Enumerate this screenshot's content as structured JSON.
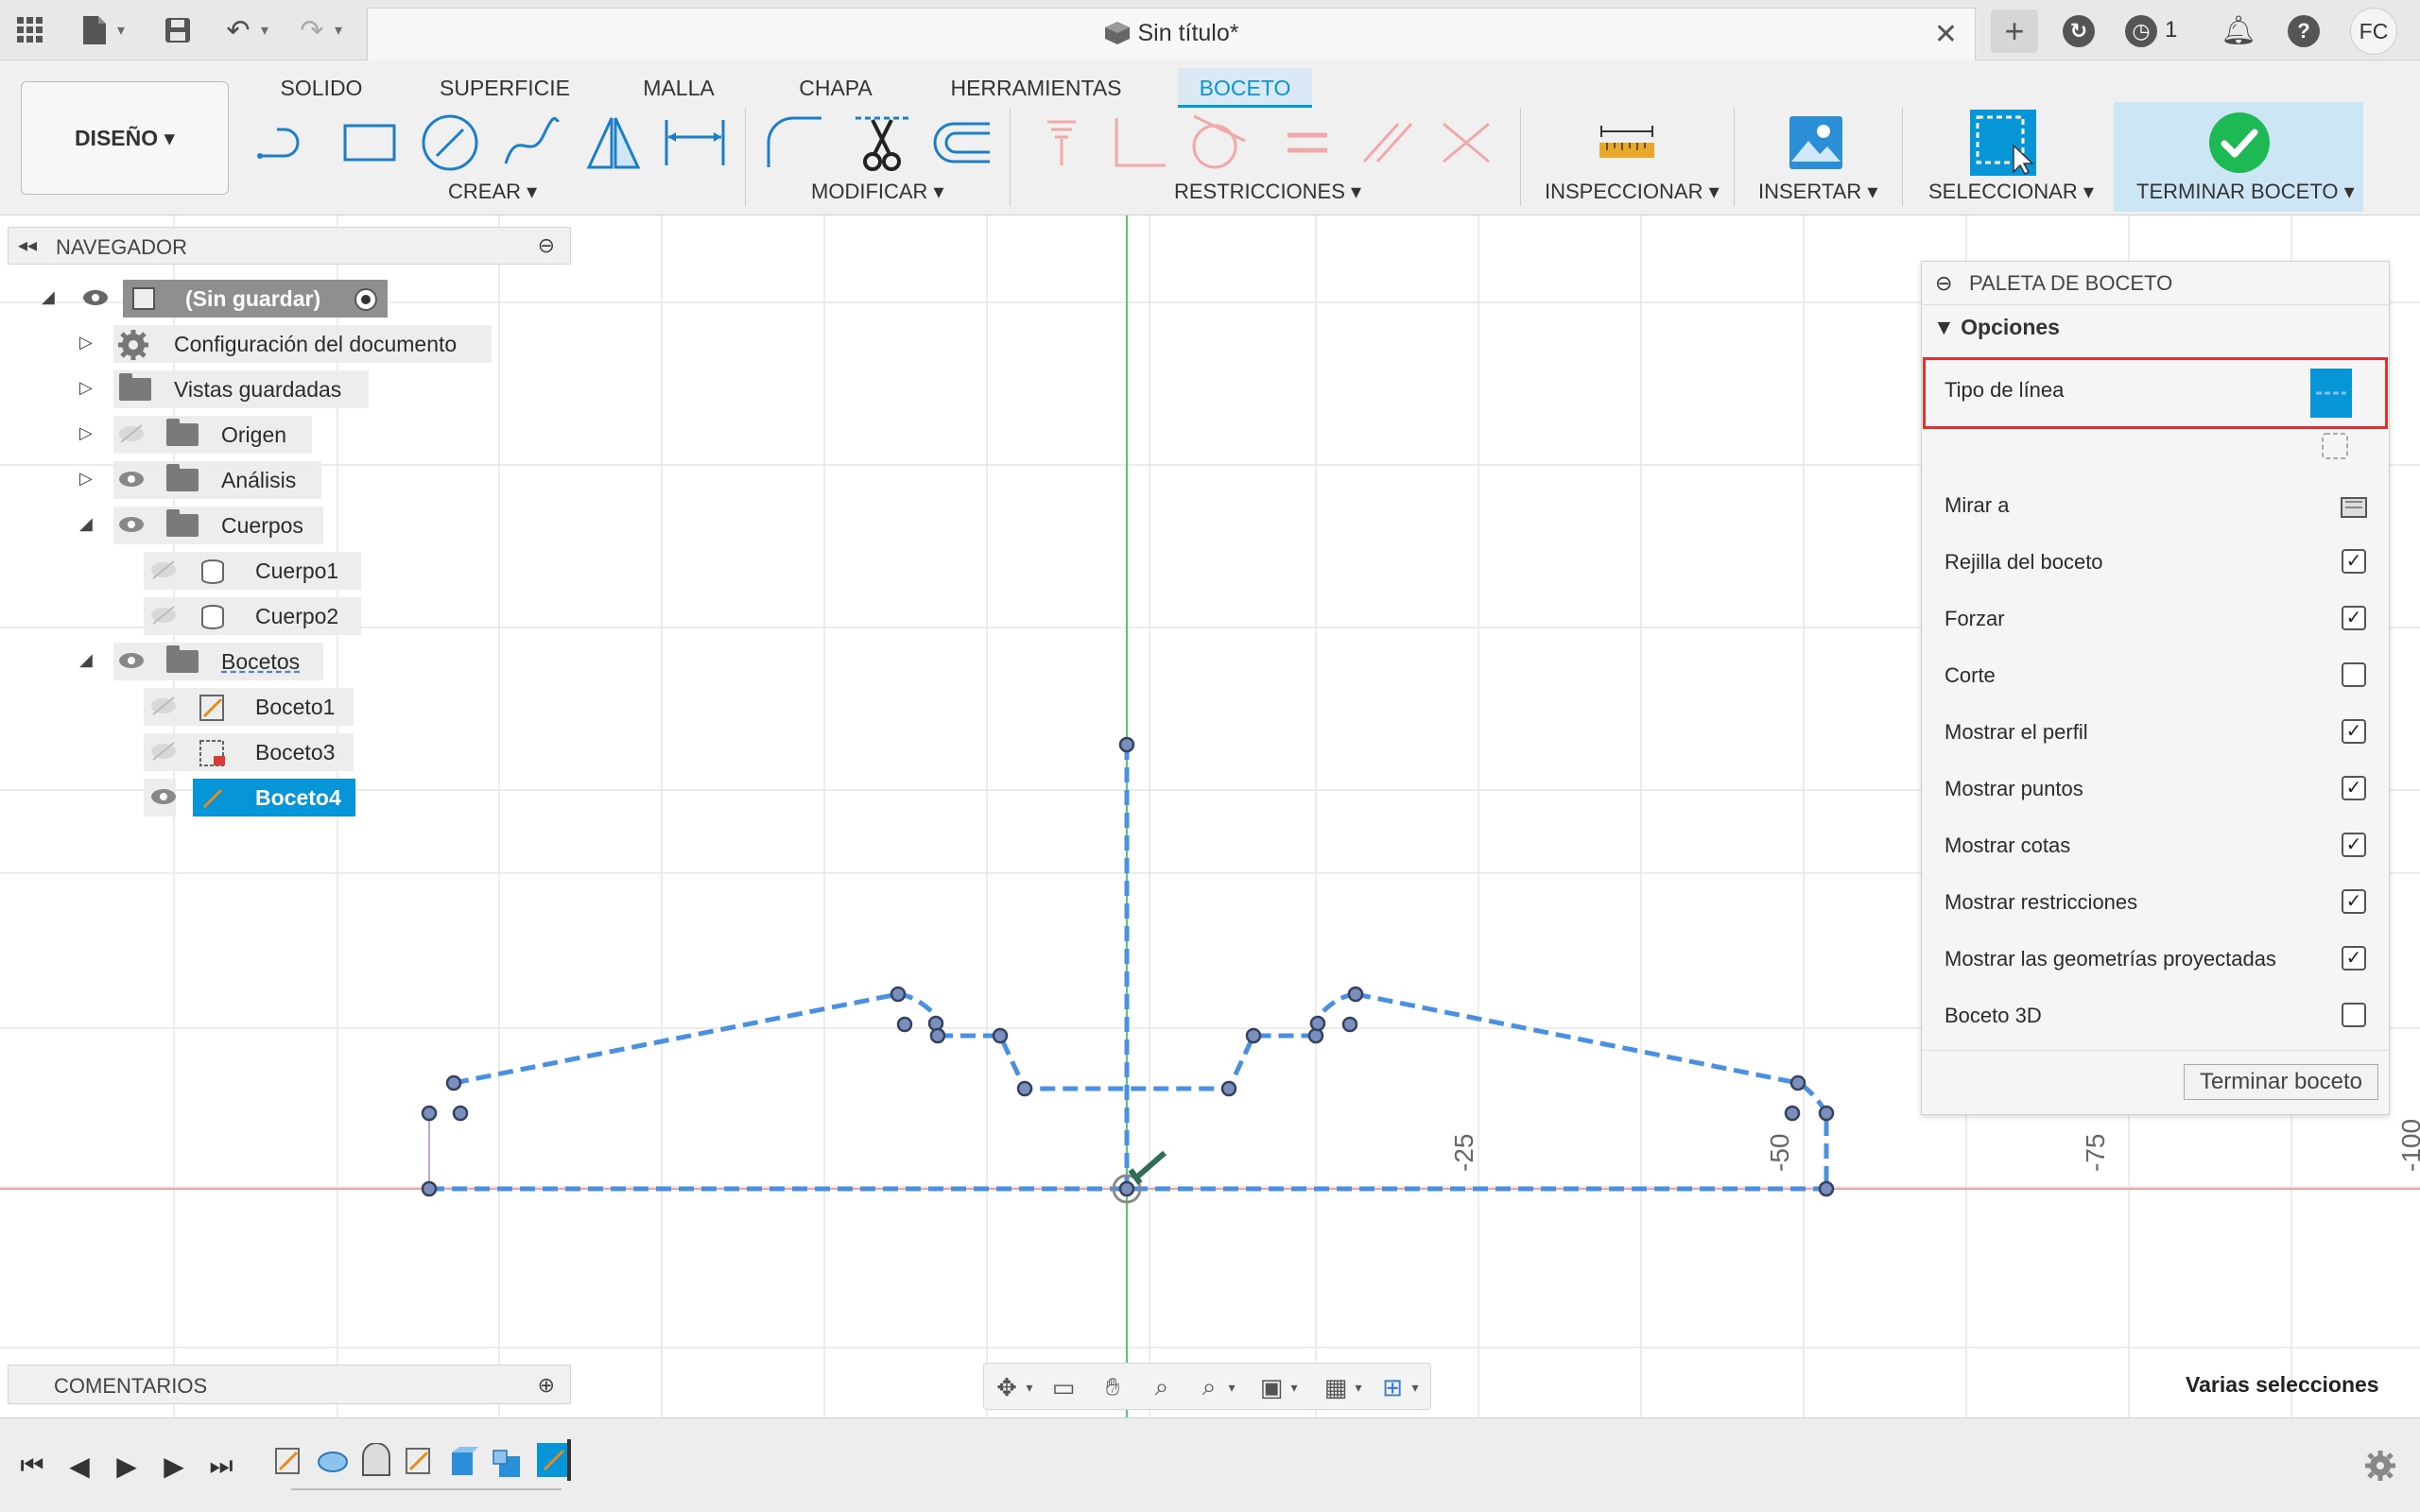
{
  "window": {
    "title": "Sin título*",
    "active_jobs": "1",
    "user_initials": "FC"
  },
  "ribbon": {
    "tabs": [
      "SOLIDO",
      "SUPERFICIE",
      "MALLA",
      "CHAPA",
      "HERRAMIENTAS",
      "BOCETO"
    ],
    "active_tab": "BOCETO",
    "workspace": "DISEÑO ▾",
    "groups": {
      "crear": "CREAR ▾",
      "modificar": "MODIFICAR ▾",
      "restricciones": "RESTRICCIONES ▾",
      "inspeccionar": "INSPECCIONAR ▾",
      "insertar": "INSERTAR ▾",
      "seleccionar": "SELECCIONAR ▾",
      "terminar": "TERMINAR BOCETO ▾"
    }
  },
  "navigator": {
    "title": "NAVEGADOR",
    "items": [
      {
        "label": "(Sin guardar)"
      },
      {
        "label": "Configuración del documento"
      },
      {
        "label": "Vistas guardadas"
      },
      {
        "label": "Origen"
      },
      {
        "label": "Análisis"
      },
      {
        "label": "Cuerpos"
      },
      {
        "label": "Cuerpo1"
      },
      {
        "label": "Cuerpo2"
      },
      {
        "label": "Bocetos"
      },
      {
        "label": "Boceto1"
      },
      {
        "label": "Boceto3"
      },
      {
        "label": "Boceto4"
      }
    ]
  },
  "comments": {
    "title": "COMENTARIOS"
  },
  "palette": {
    "title": "PALETA DE BOCETO",
    "section": "Opciones",
    "rows": [
      {
        "label": "Tipo de línea"
      },
      {
        "label": "Mirar a"
      },
      {
        "label": "Rejilla del boceto",
        "checked": true
      },
      {
        "label": "Forzar",
        "checked": true
      },
      {
        "label": "Corte",
        "checked": false
      },
      {
        "label": "Mostrar el perfil",
        "checked": true
      },
      {
        "label": "Mostrar puntos",
        "checked": true
      },
      {
        "label": "Mostrar cotas",
        "checked": true
      },
      {
        "label": "Mostrar restricciones",
        "checked": true
      },
      {
        "label": "Mostrar las geometrías proyectadas",
        "checked": true
      },
      {
        "label": "Boceto 3D",
        "checked": false
      }
    ],
    "finish_button": "Terminar boceto"
  },
  "canvas": {
    "axis_labels": [
      "25",
      "50",
      "75",
      "100"
    ]
  },
  "status": {
    "text": "Varias selecciones"
  },
  "colors": {
    "accent": "#0696d7",
    "sketch_line": "#4a90e2",
    "highlight_box": "#e03030",
    "finish_green": "#1db954"
  }
}
